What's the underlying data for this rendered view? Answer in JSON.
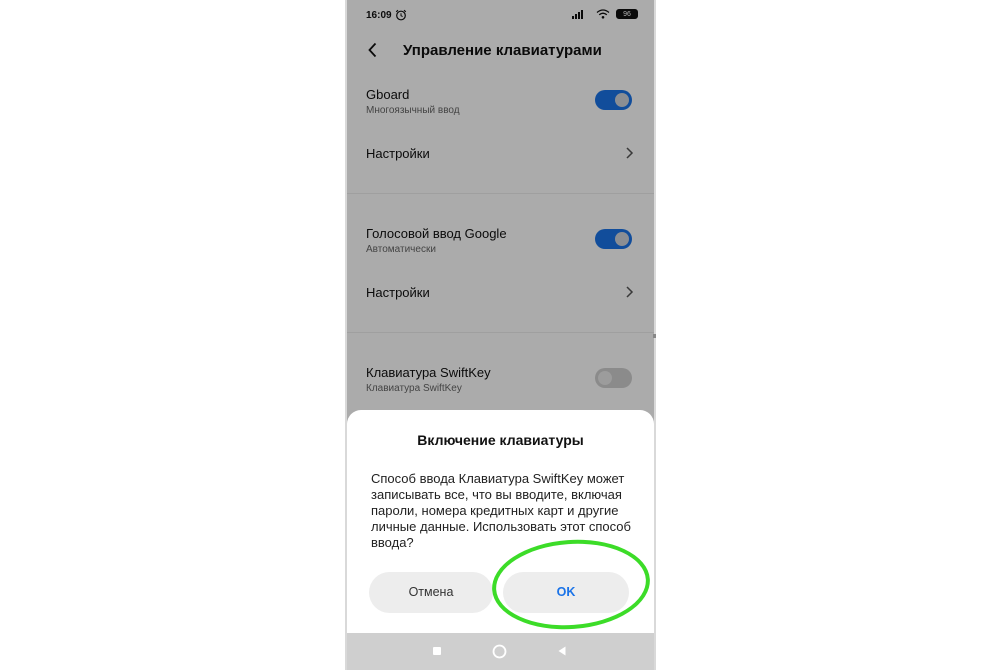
{
  "status_bar": {
    "time": "16:09",
    "battery": "96"
  },
  "header": {
    "title": "Управление клавиатурами"
  },
  "keyboards": [
    {
      "title": "Gboard",
      "subtitle": "Многоязычный ввод",
      "enabled": true,
      "settings_label": "Настройки"
    },
    {
      "title": "Голосовой ввод Google",
      "subtitle": "Автоматически",
      "enabled": true,
      "settings_label": "Настройки"
    },
    {
      "title": "Клавиатура SwiftKey",
      "subtitle": "Клавиатура SwiftKey",
      "enabled": false
    }
  ],
  "dialog": {
    "title": "Включение клавиатуры",
    "body": "Способ ввода Клавиатура SwiftKey может записывать все, что вы вводите, включая пароли, номера кредитных карт и другие личные данные. Использовать этот способ ввода?",
    "cancel_label": "Отмена",
    "ok_label": "OK"
  },
  "colors": {
    "accent": "#1a73e8",
    "highlight": "#3cdc28",
    "scrim": "rgba(0,0,0,0.33)"
  },
  "icons": {
    "back": "back-arrow-icon",
    "chevron": "chevron-right-icon",
    "alarm": "alarm-clock-icon",
    "wifi": "wifi-icon",
    "signal": "signal-icon",
    "battery": "battery-icon",
    "nav_recents": "square-icon",
    "nav_home": "circle-icon",
    "nav_back": "triangle-back-icon"
  }
}
